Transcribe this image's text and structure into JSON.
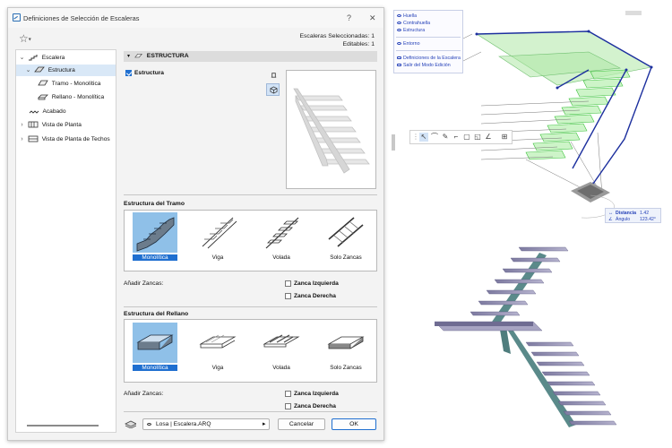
{
  "dialog": {
    "title": "Definiciones de Selección de Escaleras",
    "help": "?",
    "close": "✕",
    "selected_count": "Escaleras Seleccionadas: 1",
    "editable_count": "Editables: 1"
  },
  "tree": {
    "items": [
      {
        "label": "Escalera",
        "chevron": "⌄"
      },
      {
        "label": "Estructura",
        "chevron": "⌄"
      },
      {
        "label": "Tramo - Monolítica"
      },
      {
        "label": "Rellano - Monolítica"
      },
      {
        "label": "Acabado"
      },
      {
        "label": "Vista de Planta",
        "chevron": "›"
      },
      {
        "label": "Vista de Planta de Techos",
        "chevron": "›"
      }
    ]
  },
  "panel": {
    "header": "ESTRUCTURA",
    "estructura_checkbox": "Estructura",
    "tramo_title": "Estructura del Tramo",
    "tramo_options": [
      {
        "label": "Monolítica",
        "selected": true
      },
      {
        "label": "Viga",
        "selected": false
      },
      {
        "label": "Volada",
        "selected": false
      },
      {
        "label": "Solo Zancas",
        "selected": false
      }
    ],
    "tramo_zancas_label": "Añadir Zancas:",
    "tramo_zanca_izq": "Zanca Izquierda",
    "tramo_zanca_der": "Zanca Derecha",
    "rellano_title": "Estructura del Rellano",
    "rellano_options": [
      {
        "label": "Monolítica",
        "selected": true
      },
      {
        "label": "Viga",
        "selected": false
      },
      {
        "label": "Volada",
        "selected": false
      },
      {
        "label": "Solo Zancas",
        "selected": false
      }
    ],
    "rellano_zancas_label": "Añadir Zancas:",
    "rellano_zanca_izq": "Zanca Izquierda",
    "rellano_zanca_der": "Zanca Derecha"
  },
  "footer": {
    "layer": "Losa | Escalera.ARQ",
    "cancel": "Cancelar",
    "ok": "OK"
  },
  "view3d": {
    "popup": [
      "Huella",
      "Contrahuella",
      "Estructura",
      "Entorno",
      "Definiciones de la Escalera",
      "Salir del Modo Edición"
    ],
    "distance_label": "Distancia",
    "distance_value": "1.42",
    "angle_label": "Ángulo",
    "angle_value": "123.42°"
  },
  "colors": {
    "accent": "#1f6fd0",
    "selection_green": "#3cc23c",
    "edge_blue": "#1c2f9e"
  }
}
